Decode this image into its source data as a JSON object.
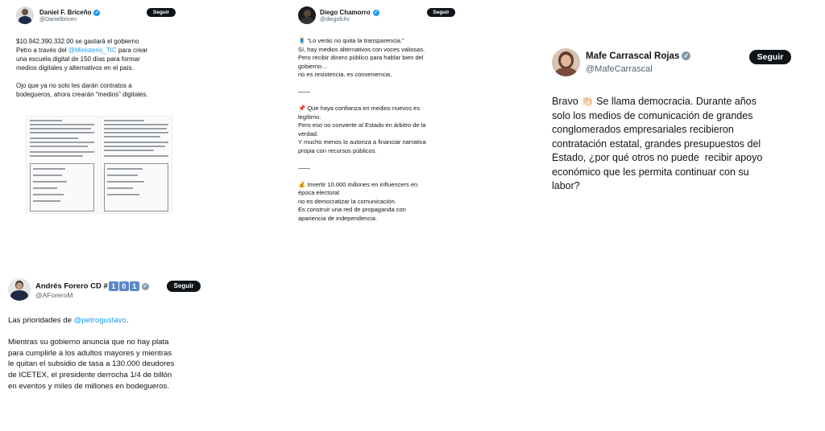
{
  "tweets": [
    {
      "name": "Daniel F. Briceño",
      "handle": "@Danielbricen",
      "follow_label": "Seguir",
      "verified_color": "#1d9bf0",
      "text_a": "$10.942.390.332.00 se gastará el gobierno\nPetro a través del ",
      "mention": "@Ministerio_TIC",
      "text_b": " para crear\nuna escuela digital de 150 días para formar\nmedios digitales y alternativos en el país.\n\nOjo que ya no solo les darán contratos a\nbodegueros, ahora crearán “medios” digitales."
    },
    {
      "name": "Diego Chamorro",
      "handle": "@diegofchv",
      "follow_label": "Seguir",
      "verified_color": "#1d9bf0",
      "text": "🧵 “Lo verás no quita la transparencia.”\nSí, hay medios alternativos con voces valiosas.\nPero recibir dinero público para hablar bien del\ngobierno…\nno es resistencia, es conveniencia.\n\n——\n\n📌 Que haya confianza en medios nuevos es\nlegítimo.\nPero eso no convierte al Estado en árbitro de la\nverdad.\nY mucho menos lo autoriza a financiar narrativa\npropia con recursos públicos.\n\n——\n\n💰 Invertir 10.000 millones en influencers en\népoca electoral\nno es democratizar la comunicación.\nEs construir una red de propaganda con\napariencia de independencia."
    },
    {
      "name": "Mafe Carrascal Rojas",
      "handle": "@MafeCarrascal",
      "follow_label": "Seguir",
      "verified_color": "#829aab",
      "text": "Bravo 👏🏻 Se llama democracia. Durante años\nsolo los medios de comunicación de grandes\nconglomerados empresariales recibieron\ncontratación estatal, grandes presupuestos del\nEstado, ¿por qué otros no puede  recibir apoyo\neconómico que les permita continuar con su\nlabor?"
    },
    {
      "name": "Andrés Forero CD #",
      "name_badges": [
        "1",
        "0",
        "1"
      ],
      "handle": "@AForeroM",
      "follow_label": "Seguir",
      "verified_color": "#829aab",
      "text_a": "Las prioridades de ",
      "mention": "@petrogustavo",
      "text_b": ".\n\nMientras su gobierno anuncia que no hay plata\npara cumplirle a los adultos mayores y mientras\nle quitan el subsidio de tasa a 130.000 deudores\nde ICETEX, el presidente derrocha 1/4 de billón\nen eventos y miles de millones en bodegueros."
    }
  ]
}
